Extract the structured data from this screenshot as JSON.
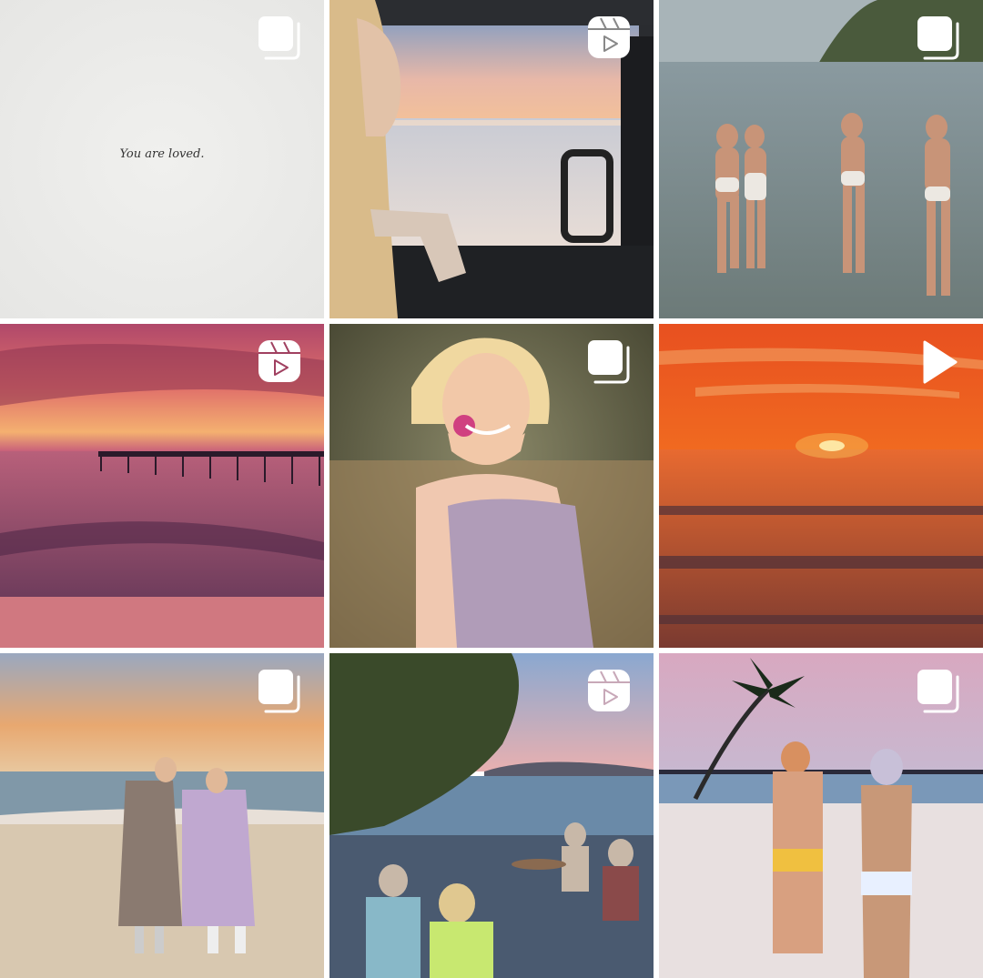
{
  "grid": {
    "posts": [
      {
        "type": "carousel",
        "badge_icon": "carousel-icon",
        "text": "You are loved."
      },
      {
        "type": "reel",
        "badge_icon": "reel-icon"
      },
      {
        "type": "carousel",
        "badge_icon": "carousel-icon"
      },
      {
        "type": "reel",
        "badge_icon": "reel-icon"
      },
      {
        "type": "carousel",
        "badge_icon": "carousel-icon"
      },
      {
        "type": "video",
        "badge_icon": "play-icon"
      },
      {
        "type": "carousel",
        "badge_icon": "carousel-icon"
      },
      {
        "type": "reel",
        "badge_icon": "reel-icon"
      },
      {
        "type": "carousel",
        "badge_icon": "carousel-icon"
      }
    ]
  },
  "colors": {
    "background": "#ffffff",
    "badge": "#ffffff"
  }
}
